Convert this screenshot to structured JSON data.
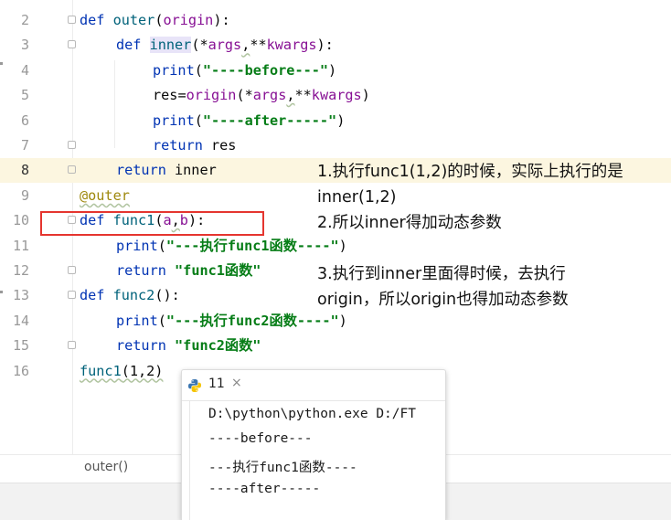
{
  "editor": {
    "lines": [
      {
        "num": "2",
        "fold": true,
        "highlight": false,
        "indent": 0,
        "tokens": [
          {
            "t": "def",
            "c": "kw"
          },
          {
            "t": " "
          },
          {
            "t": "outer",
            "c": "fn"
          },
          {
            "t": "("
          },
          {
            "t": "origin",
            "c": "param"
          },
          {
            "t": "):"
          }
        ]
      },
      {
        "num": "3",
        "fold": true,
        "highlight": false,
        "indent": 1,
        "tokens": [
          {
            "t": "def",
            "c": "kw"
          },
          {
            "t": " "
          },
          {
            "t": "inner",
            "c": "fn inner-hl"
          },
          {
            "t": "(*"
          },
          {
            "t": "args",
            "c": "param"
          },
          {
            "t": ",",
            "c": "sq"
          },
          {
            "t": "**"
          },
          {
            "t": "kwargs",
            "c": "param"
          },
          {
            "t": "):"
          }
        ]
      },
      {
        "num": "4",
        "fold": false,
        "highlight": false,
        "indent": 2,
        "tokens": [
          {
            "t": "print",
            "c": "kw"
          },
          {
            "t": "("
          },
          {
            "t": "\"----before---\"",
            "c": "str"
          },
          {
            "t": ")"
          }
        ]
      },
      {
        "num": "5",
        "fold": false,
        "highlight": false,
        "indent": 2,
        "tokens": [
          {
            "t": "res"
          },
          {
            "t": "="
          },
          {
            "t": "origin",
            "c": "param"
          },
          {
            "t": "(*"
          },
          {
            "t": "args",
            "c": "param"
          },
          {
            "t": ",",
            "c": "sq"
          },
          {
            "t": "**"
          },
          {
            "t": "kwargs",
            "c": "param"
          },
          {
            "t": ")"
          }
        ]
      },
      {
        "num": "6",
        "fold": false,
        "highlight": false,
        "indent": 2,
        "tokens": [
          {
            "t": "print",
            "c": "kw"
          },
          {
            "t": "("
          },
          {
            "t": "\"----after-----\"",
            "c": "str"
          },
          {
            "t": ")"
          }
        ]
      },
      {
        "num": "7",
        "fold": true,
        "highlight": false,
        "indent": 2,
        "tokens": [
          {
            "t": "return",
            "c": "kw"
          },
          {
            "t": " res"
          }
        ]
      },
      {
        "num": "8",
        "fold": true,
        "highlight": true,
        "indent": 1,
        "tokens": [
          {
            "t": "return",
            "c": "kw"
          },
          {
            "t": " inner"
          }
        ]
      },
      {
        "num": "9",
        "fold": false,
        "highlight": false,
        "indent": 0,
        "tokens": [
          {
            "t": "@outer",
            "c": "deco sq"
          }
        ]
      },
      {
        "num": "10",
        "fold": true,
        "highlight": false,
        "indent": 0,
        "tokens": [
          {
            "t": "def",
            "c": "kw"
          },
          {
            "t": " "
          },
          {
            "t": "func1",
            "c": "fn"
          },
          {
            "t": "("
          },
          {
            "t": "a",
            "c": "param"
          },
          {
            "t": ",",
            "c": "sq"
          },
          {
            "t": "b",
            "c": "param"
          },
          {
            "t": "):"
          }
        ]
      },
      {
        "num": "11",
        "fold": false,
        "highlight": false,
        "indent": 1,
        "tokens": [
          {
            "t": "print",
            "c": "kw"
          },
          {
            "t": "("
          },
          {
            "t": "\"---执行func1函数----\"",
            "c": "str"
          },
          {
            "t": ")"
          }
        ]
      },
      {
        "num": "12",
        "fold": true,
        "highlight": false,
        "indent": 1,
        "tokens": [
          {
            "t": "return",
            "c": "kw"
          },
          {
            "t": " "
          },
          {
            "t": "\"func1函数\"",
            "c": "str"
          }
        ]
      },
      {
        "num": "13",
        "fold": true,
        "highlight": false,
        "indent": 0,
        "tokens": [
          {
            "t": "def",
            "c": "kw"
          },
          {
            "t": " "
          },
          {
            "t": "func2",
            "c": "fn"
          },
          {
            "t": "():"
          }
        ]
      },
      {
        "num": "14",
        "fold": false,
        "highlight": false,
        "indent": 1,
        "tokens": [
          {
            "t": "print",
            "c": "kw"
          },
          {
            "t": "("
          },
          {
            "t": "\"---执行func2函数----\"",
            "c": "str"
          },
          {
            "t": ")"
          }
        ]
      },
      {
        "num": "15",
        "fold": true,
        "highlight": false,
        "indent": 1,
        "tokens": [
          {
            "t": "return",
            "c": "kw"
          },
          {
            "t": " "
          },
          {
            "t": "\"func2函数\"",
            "c": "str"
          }
        ]
      },
      {
        "num": "16",
        "fold": false,
        "highlight": false,
        "indent": 0,
        "tokens": [
          {
            "t": "func1",
            "c": "fn sq"
          },
          {
            "t": "(1,2)",
            "c": "sq"
          }
        ]
      }
    ]
  },
  "annotations": {
    "note1_line1": "1.执行func1(1,2)的时候，实际上执行的是",
    "note1_line2": "inner(1,2)",
    "note2": "2.所以inner得加动态参数",
    "note3_line1": "3.执行到inner里面得时候，去执行",
    "note3_line2": "origin，所以origin也得加动态参数"
  },
  "breadcrumb": "outer()",
  "run_panel": {
    "tab_title": "11",
    "close": "×",
    "icon": "python-icon",
    "output": [
      "D:\\python\\python.exe D:/FT",
      "----before---",
      "---执行func1函数----",
      "----after-----"
    ]
  },
  "colors": {
    "keyword": "#0033b3",
    "function": "#00627a",
    "string": "#067d17",
    "param": "#871094",
    "decorator": "#9e880d",
    "highlight_line": "#fcf6e0",
    "red_box": "#e5352f"
  }
}
